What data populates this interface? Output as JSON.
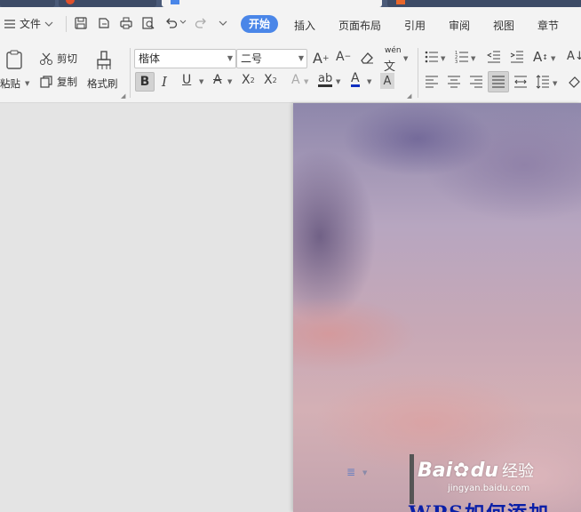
{
  "menubar": {
    "file_label": "文件",
    "tabs": [
      "开始",
      "插入",
      "页面布局",
      "引用",
      "审阅",
      "视图",
      "章节"
    ]
  },
  "ribbon": {
    "paste_label": "粘贴",
    "cut_label": "剪切",
    "copy_label": "复制",
    "format_painter_label": "格式刷",
    "font_name": "楷体",
    "font_size": "二号"
  },
  "watermark": {
    "brand": "Bai",
    "brand2": "du",
    "suffix": "经验",
    "url": "jingyan.baidu.com"
  },
  "document": {
    "heading_fragment": "WPS如何添加"
  },
  "colors": {
    "accent_tab": "#4a86e8",
    "heading": "#0a1fa8"
  }
}
